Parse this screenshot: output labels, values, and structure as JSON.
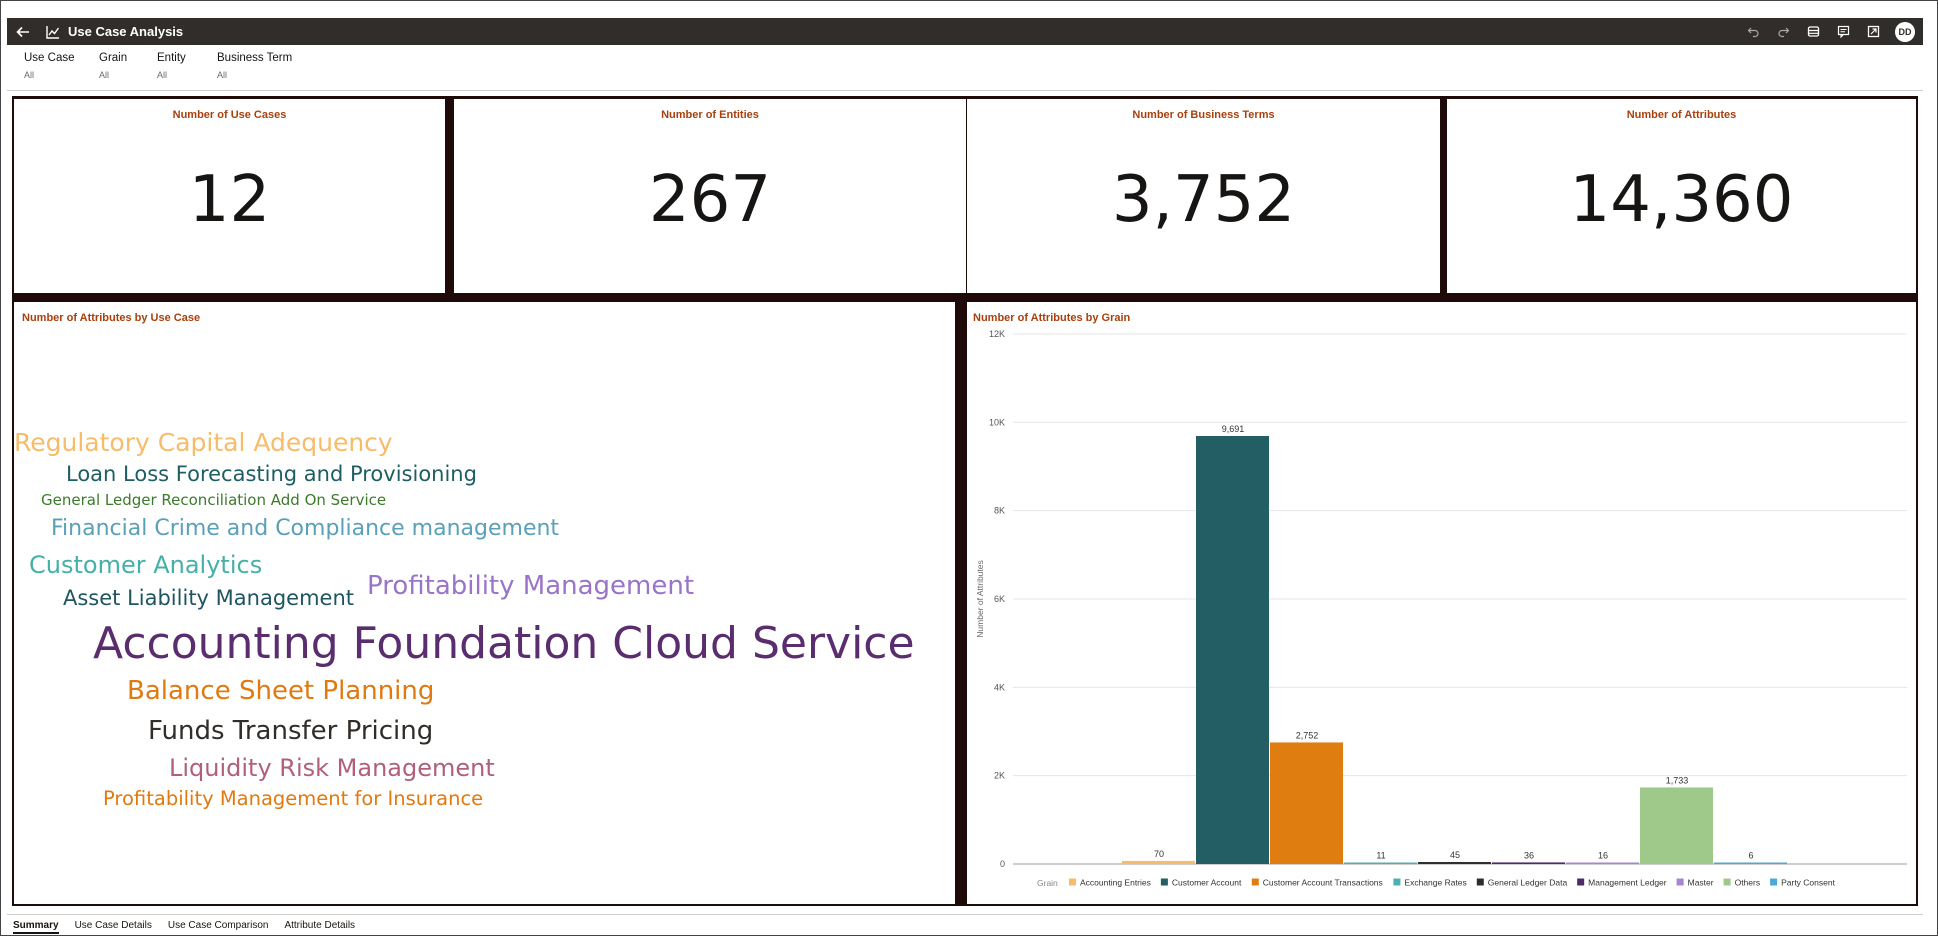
{
  "app": {
    "title": "Use Case Analysis",
    "user_initials": "DD"
  },
  "toolbar_icons": [
    "undo-icon",
    "redo-icon",
    "data-icon",
    "comment-icon",
    "present-icon"
  ],
  "filters": [
    {
      "label": "Use Case",
      "value": "All"
    },
    {
      "label": "Grain",
      "value": "All"
    },
    {
      "label": "Entity",
      "value": "All"
    },
    {
      "label": "Business Term",
      "value": "All"
    }
  ],
  "kpis": [
    {
      "title": "Number of Use Cases",
      "value": "12"
    },
    {
      "title": "Number of Entities",
      "value": "267"
    },
    {
      "title": "Number of Business Terms",
      "value": "3,752"
    },
    {
      "title": "Number of Attributes",
      "value": "14,360"
    }
  ],
  "wordcloud": {
    "title": "Number of Attributes by Use Case",
    "words": [
      {
        "text": "Regulatory Capital Adequency",
        "color": "#f7bc6a"
      },
      {
        "text": "Loan Loss Forecasting and Provisioning",
        "color": "#1e5e62"
      },
      {
        "text": "General Ledger Reconciliation Add On Service",
        "color": "#3d7a2c"
      },
      {
        "text": "Financial Crime and Compliance management",
        "color": "#5aa0b8"
      },
      {
        "text": "Customer Analytics",
        "color": "#45b0a8"
      },
      {
        "text": "Profitability Management",
        "color": "#9a74c9"
      },
      {
        "text": "Asset Liability Management",
        "color": "#1e5560"
      },
      {
        "text": "Accounting Foundation Cloud Service",
        "color": "#5a2e6e"
      },
      {
        "text": "Balance Sheet Planning",
        "color": "#e07a10"
      },
      {
        "text": "Funds Transfer Pricing",
        "color": "#312d2a"
      },
      {
        "text": "Liquidity Risk Management",
        "color": "#b0607a"
      },
      {
        "text": "Profitability Management for Insurance",
        "color": "#e07a10"
      }
    ]
  },
  "chart_data": {
    "type": "bar",
    "title": "Number of Attributes by Grain",
    "xlabel": "",
    "ylabel": "Number of Attributes",
    "ylim": [
      0,
      12000
    ],
    "yticks": [
      "0",
      "2K",
      "4K",
      "6K",
      "8K",
      "10K",
      "12K"
    ],
    "legend_title": "Grain",
    "legend_position": "bottom",
    "grid": true,
    "categories": [
      "Accounting Entries",
      "Customer Account",
      "Customer Account Transactions",
      "Exchange Rates",
      "General Ledger Data",
      "Management Ledger",
      "Master",
      "Others",
      "Party Consent"
    ],
    "values": [
      70,
      9691,
      2752,
      11,
      45,
      36,
      16,
      1733,
      6
    ],
    "value_labels": [
      "70",
      "9,691",
      "2,752",
      "11",
      "45",
      "36",
      "16",
      "1,733",
      "6"
    ],
    "colors": [
      "#f7bc6a",
      "#225e64",
      "#e07d10",
      "#4cb0b0",
      "#312d2a",
      "#4a2c6e",
      "#a585d4",
      "#9fc98a",
      "#4ca8d8"
    ]
  },
  "tabs": [
    {
      "label": "Summary",
      "active": true
    },
    {
      "label": "Use Case Details",
      "active": false
    },
    {
      "label": "Use Case Comparison",
      "active": false
    },
    {
      "label": "Attribute Details",
      "active": false
    }
  ]
}
